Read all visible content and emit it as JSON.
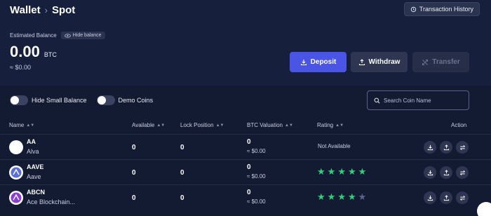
{
  "breadcrumb": {
    "root": "Wallet",
    "current": "Spot"
  },
  "header": {
    "transaction_history": "Transaction History",
    "estimated_balance_label": "Estimated Balance",
    "hide_balance": "Hide balance",
    "balance": "0.00",
    "balance_unit": "BTC",
    "balance_usd": "≈ $0.00",
    "deposit": "Deposit",
    "withdraw": "Withdraw",
    "transfer": "Transfer"
  },
  "filters": {
    "hide_small_balance": "Hide Small Balance",
    "demo_coins": "Demo Coins",
    "search_placeholder": "Search Coin Name"
  },
  "table": {
    "columns": {
      "name": "Name",
      "available": "Available",
      "lock_position": "Lock Position",
      "btc_valuation": "BTC Valuation",
      "rating": "Rating",
      "action": "Action"
    },
    "rows": [
      {
        "symbol": "AA",
        "name": "Alva",
        "available": "0",
        "lock": "0",
        "btc": "0",
        "usd": "≈ $0.00",
        "rating_text": "Not Available",
        "rating": 0,
        "icon_color": "#ffffff",
        "icon_name": "alva-coin-icon"
      },
      {
        "symbol": "AAVE",
        "name": "Aave",
        "available": "0",
        "lock": "0",
        "btc": "0",
        "usd": "≈ $0.00",
        "rating_text": "",
        "rating": 5,
        "icon_color": "#5a6ed6",
        "icon_name": "aave-coin-icon"
      },
      {
        "symbol": "ABCN",
        "name": "Ace Blockchain...",
        "available": "0",
        "lock": "0",
        "btc": "0",
        "usd": "≈ $0.00",
        "rating_text": "",
        "rating": 4,
        "icon_color": "#8a3fd1",
        "icon_name": "abcn-coin-icon"
      }
    ]
  },
  "colors": {
    "accent": "#4a55e6",
    "star": "#2fd07a",
    "background": "#131b33"
  }
}
